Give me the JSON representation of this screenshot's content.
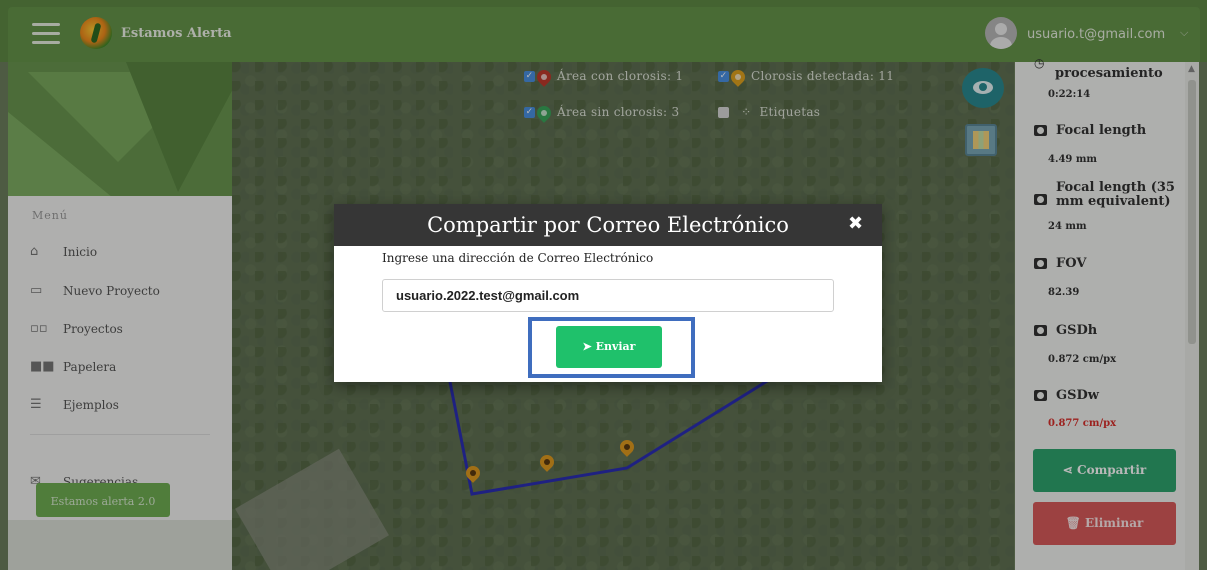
{
  "app": {
    "title": "Estamos Alerta",
    "user_email": "usuario.t@gmail.com"
  },
  "sidebar": {
    "menu_title": "Menú",
    "items": [
      {
        "label": "Inicio",
        "icon": "home-icon"
      },
      {
        "label": "Nuevo Proyecto",
        "icon": "new-project-icon"
      },
      {
        "label": "Proyectos",
        "icon": "grid-icon"
      },
      {
        "label": "Papelera",
        "icon": "trash-grid-icon"
      },
      {
        "label": "Ejemplos",
        "icon": "list-icon"
      }
    ],
    "suggestions": {
      "label": "Sugerencias",
      "icon": "mail-icon"
    },
    "footer_button": "Estamos alerta 2.0"
  },
  "legend": {
    "area_con_clorosis": "Área con clorosis: 1",
    "clorosis_detectada": "Clorosis detectada: 11",
    "area_sin_clorosis": "Área sin clorosis: 3",
    "etiquetas": "Etiquetas"
  },
  "colors": {
    "topbar": "#66954a",
    "modal_header": "#363636",
    "send_button": "#1fc16b",
    "share_button": "#2fa46e",
    "delete_button": "#d85b5b",
    "highlight": "#3f6dbe",
    "boundary": "#2b2fb5",
    "pin": "#e09a1f"
  },
  "right_panel": {
    "processing_label": "procesamiento",
    "processing_value": "0:22:14",
    "focal_length_label": "Focal length",
    "focal_length_value": "4.49 mm",
    "focal_length_35_label": "Focal length (35 mm equivalent)",
    "focal_length_35_value": "24 mm",
    "fov_label": "FOV",
    "fov_value": "82.39",
    "gsdh_label": "GSDh",
    "gsdh_value": "0.872 cm/px",
    "gsdw_label": "GSDw",
    "gsdw_value": "0.877 cm/px",
    "share_button": "Compartir",
    "delete_button": "Eliminar"
  },
  "modal": {
    "title": "Compartir por Correo Electrónico",
    "close": "✖",
    "label": "Ingrese una dirección de Correo Electrónico",
    "email_value": "usuario.2022.test@gmail.com",
    "send_button": "Enviar"
  }
}
